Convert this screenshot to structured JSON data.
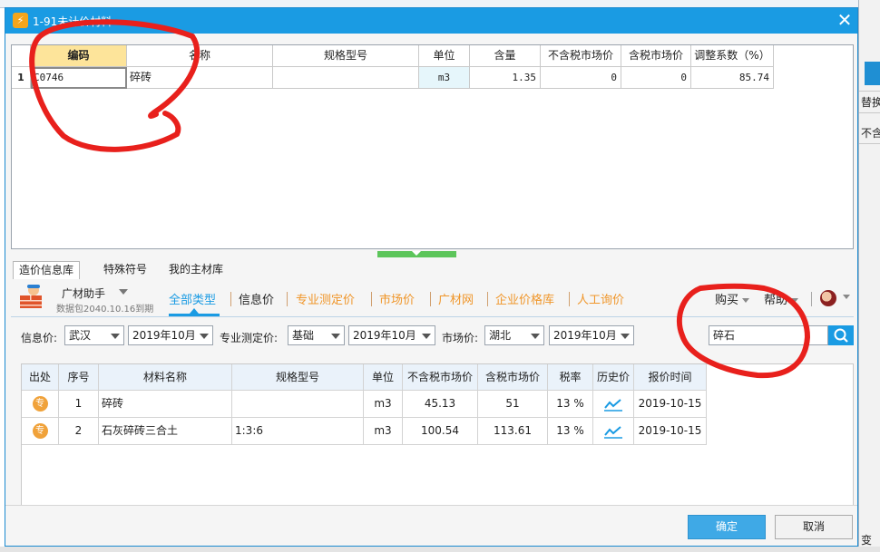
{
  "background": {
    "right_labels": [
      "替换",
      "不含"
    ],
    "bottom_label": "变"
  },
  "dialog": {
    "title": "1-91未计价材料",
    "title_icon": "gear-lightning-icon",
    "close_icon": "close-icon"
  },
  "top_grid": {
    "headers": [
      "编码",
      "名称",
      "规格型号",
      "单位",
      "含量",
      "不含税市场价",
      "含税市场价",
      "调整系数（%）"
    ],
    "rows": [
      {
        "rownum": "1",
        "code": "C0746",
        "name": "碎砖",
        "spec": "",
        "unit": "m3",
        "qty": "1.35",
        "price_ex": "0",
        "price_inc": "0",
        "adjust": "85.74"
      }
    ]
  },
  "lib_tabs": [
    "造价信息库",
    "特殊符号",
    "我的主材库"
  ],
  "nav": {
    "helper_name": "广材助手",
    "helper_sub": "数据包2040.10.16到期",
    "links": [
      "全部类型",
      "信息价",
      "专业测定价",
      "市场价",
      "广材网",
      "企业价格库",
      "人工询价"
    ],
    "buy": "购买",
    "help": "帮助",
    "colors": {
      "active": "#1a9be3",
      "orange": "#f0962a"
    }
  },
  "filters": {
    "info_price_label": "信息价:",
    "city": "武汉",
    "info_month": "2019年10月",
    "pro_label": "专业测定价:",
    "pro_type": "基础",
    "pro_month": "2019年10月",
    "market_label": "市场价:",
    "province": "湖北",
    "market_month": "2019年10月",
    "search_value": "碎石",
    "search_icon": "search-icon"
  },
  "results": {
    "headers": [
      "出处",
      "序号",
      "材料名称",
      "规格型号",
      "单位",
      "不含税市场价",
      "含税市场价",
      "税率",
      "历史价",
      "报价时间"
    ],
    "rows": [
      {
        "source": "专",
        "seq": "1",
        "name": "碎砖",
        "spec": "",
        "unit": "m3",
        "price_ex": "45.13",
        "price_inc": "51",
        "tax": "13 %",
        "history_icon": "trend-chart-icon",
        "date": "2019-10-15"
      },
      {
        "source": "专",
        "seq": "2",
        "name": "石灰碎砖三合土",
        "spec": "1:3:6",
        "unit": "m3",
        "price_ex": "100.54",
        "price_inc": "113.61",
        "tax": "13 %",
        "history_icon": "trend-chart-icon",
        "date": "2019-10-15"
      }
    ]
  },
  "footer": {
    "ok": "确定",
    "cancel": "取消"
  }
}
